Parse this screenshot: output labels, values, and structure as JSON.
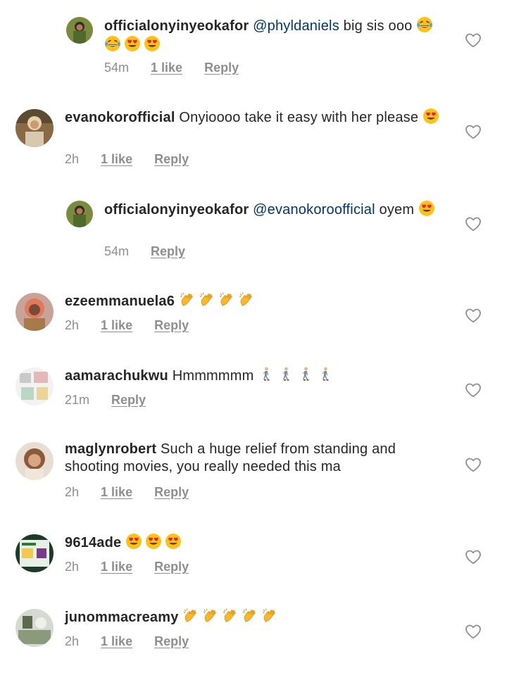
{
  "comments": [
    {
      "user": "officialonyinyeokafor",
      "mention": "@phyldaniels",
      "text": "big sis ooo",
      "emojis": [
        "joy",
        "joy",
        "heart-eyes",
        "heart-eyes"
      ],
      "time": "54m",
      "likes": "1 like",
      "reply": "Reply"
    },
    {
      "user": "evanokorofficial",
      "mention": "",
      "text": "Onyioooo take it easy with her please",
      "emojis": [
        "heart-eyes"
      ],
      "time": "2h",
      "likes": "1 like",
      "reply": "Reply"
    },
    {
      "user": "officialonyinyeokafor",
      "mention": "@evanokoroofficial",
      "text": "oyem",
      "emojis": [
        "heart-eyes"
      ],
      "time": "54m",
      "likes": "",
      "reply": "Reply"
    },
    {
      "user": "ezeemmanuela6",
      "mention": "",
      "text": "",
      "emojis": [
        "clap",
        "clap",
        "clap",
        "clap"
      ],
      "time": "2h",
      "likes": "1 like",
      "reply": "Reply"
    },
    {
      "user": "aamarachukwu",
      "mention": "",
      "text": "Hmmmmmm",
      "emojis": [
        "walking",
        "walking",
        "walking",
        "walking"
      ],
      "time": "21m",
      "likes": "",
      "reply": "Reply"
    },
    {
      "user": "maglynrobert",
      "mention": "",
      "text": "Such a huge relief from standing and shooting movies, you really needed this ma",
      "emojis": [],
      "time": "2h",
      "likes": "1 like",
      "reply": "Reply"
    },
    {
      "user": "9614ade",
      "mention": "",
      "text": "",
      "emojis": [
        "heart-eyes",
        "heart-eyes",
        "heart-eyes"
      ],
      "time": "2h",
      "likes": "1 like",
      "reply": "Reply"
    },
    {
      "user": "junommacreamy",
      "mention": "",
      "text": "",
      "emojis": [
        "clap",
        "clap",
        "clap",
        "clap",
        "clap"
      ],
      "time": "2h",
      "likes": "1 like",
      "reply": "Reply"
    }
  ],
  "colors": {
    "username": "#262626",
    "mention": "#00376b",
    "meta": "#8e8e8e",
    "heart_outline": "#8e8e8e"
  }
}
